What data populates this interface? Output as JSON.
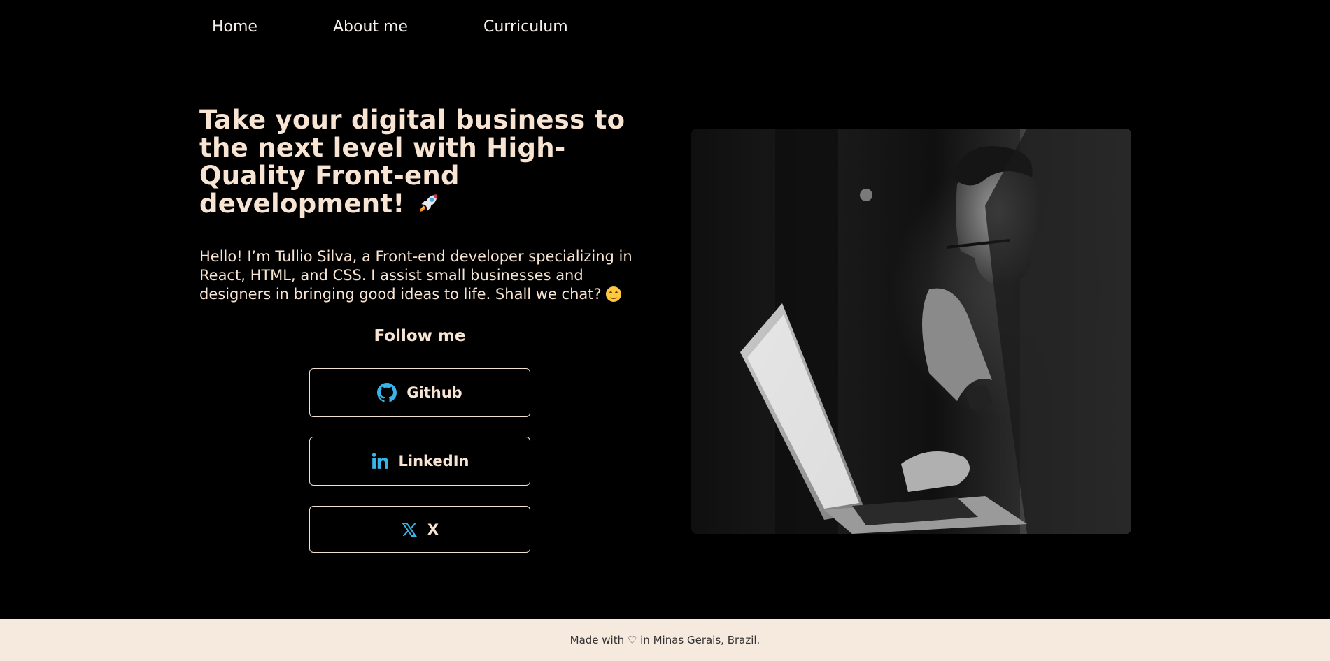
{
  "nav": {
    "items": [
      {
        "label": "Home"
      },
      {
        "label": "About me"
      },
      {
        "label": "Curriculum"
      }
    ]
  },
  "hero": {
    "title": "Take your digital business to the next level with High-Quality Front-end development!",
    "title_emoji_icon": "rocket-icon",
    "intro": "Hello! I’m Tullio Silva, a Front-end developer specializing in React, HTML, and CSS. I assist small businesses and designers in bringing good ideas to life. Shall we chat?",
    "intro_emoji_icon": "smile-icon"
  },
  "follow": {
    "heading": "Follow me",
    "buttons": [
      {
        "label": "Github",
        "icon": "github-icon"
      },
      {
        "label": "LinkedIn",
        "icon": "linkedin-icon"
      },
      {
        "label": "X",
        "icon": "x-logo-icon"
      }
    ]
  },
  "footer": {
    "text_before": "Made with",
    "heart": "♡",
    "text_after": "in Minas Gerais, Brazil."
  },
  "colors": {
    "background": "#000000",
    "text_cream": "#f8e4d2",
    "icon_blue": "#39b3e8",
    "footer_bg": "#f6e9dd"
  }
}
